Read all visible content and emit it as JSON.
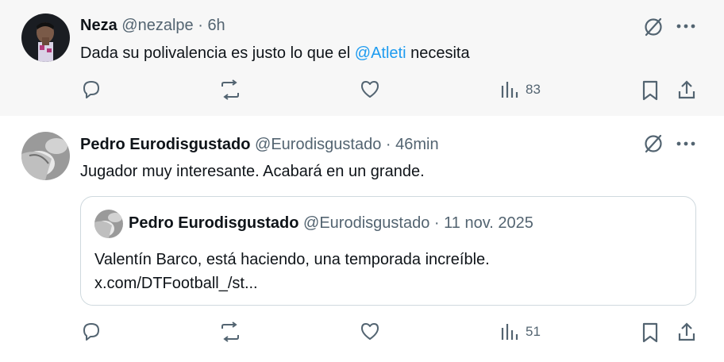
{
  "tweets": [
    {
      "name": "Neza",
      "handle": "@nezalpe",
      "separator": "·",
      "time": "6h",
      "text_before": "Dada su polivalencia es justo lo que el ",
      "mention": "@Atleti",
      "text_after": " necesita",
      "views": "83"
    },
    {
      "name": "Pedro Eurodisgustado",
      "handle": "@Eurodisgustado",
      "separator": "·",
      "time": "46min",
      "text": "Jugador muy interesante. Acabará en un grande.",
      "quote": {
        "name": "Pedro Eurodisgustado",
        "handle": "@Eurodisgustado",
        "separator": "·",
        "date": "11 nov. 2025",
        "text_line1": "Valentín Barco, está haciendo, una temporada increíble.",
        "text_line2": "x.com/DTFootball_/st..."
      },
      "views": "51"
    }
  ],
  "icons": {
    "grok": "grok-icon",
    "more": "more-icon",
    "reply": "reply-icon",
    "repost": "repost-icon",
    "like": "like-icon",
    "views": "views-icon",
    "bookmark": "bookmark-icon",
    "share": "share-icon"
  },
  "colors": {
    "link": "#1d9bf0",
    "muted": "#536471",
    "text": "#0f1419",
    "border": "#cfd9de"
  }
}
